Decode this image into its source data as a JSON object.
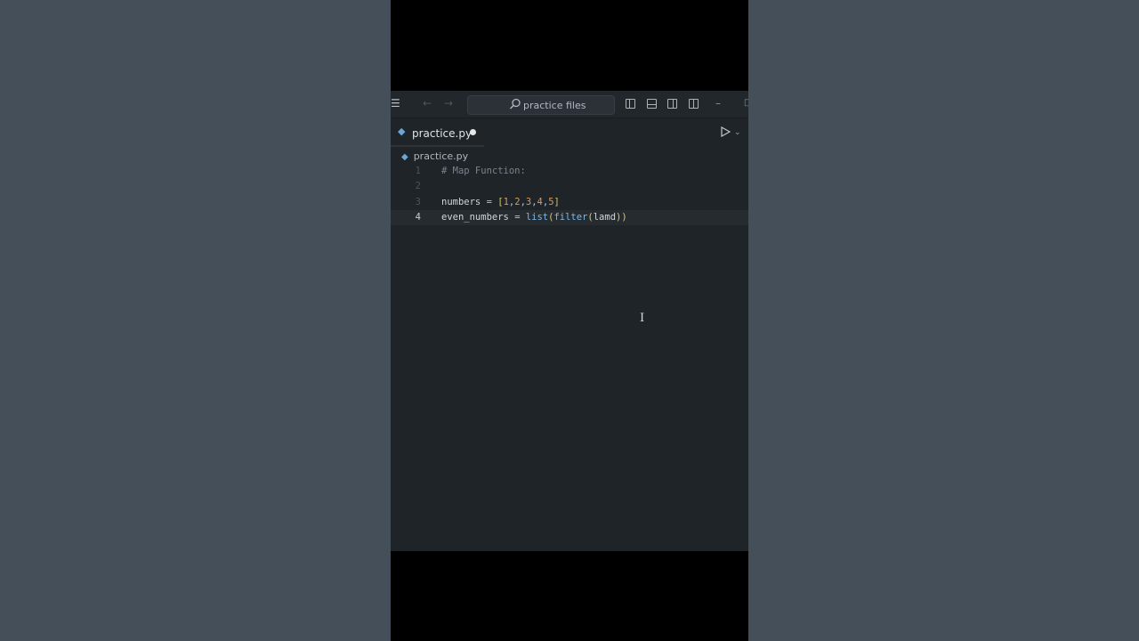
{
  "titlebar": {
    "menu_icon": "hamburger-icon",
    "back_icon": "arrow-left-icon",
    "forward_icon": "arrow-right-icon",
    "search_icon": "search-icon",
    "search_label": "practice files"
  },
  "tab": {
    "label": "practice.py",
    "icon": "python-file-icon",
    "unsaved": true
  },
  "breadcrumb": {
    "file": "practice.py"
  },
  "editor": {
    "lines": [
      {
        "number": "1",
        "text": "# Map Function:"
      },
      {
        "number": "2",
        "text": ""
      },
      {
        "number": "3",
        "text": "numbers = [1,2,3,4,5]"
      },
      {
        "number": "4",
        "text": "even_numbers = list(filter(lamd))"
      }
    ],
    "active_line": "4"
  },
  "colors": {
    "background": "#454f59",
    "editor_bg": "#1f2428",
    "python_icon": "#6aa6d6",
    "number": "#d79b62",
    "function": "#79b8e8"
  }
}
